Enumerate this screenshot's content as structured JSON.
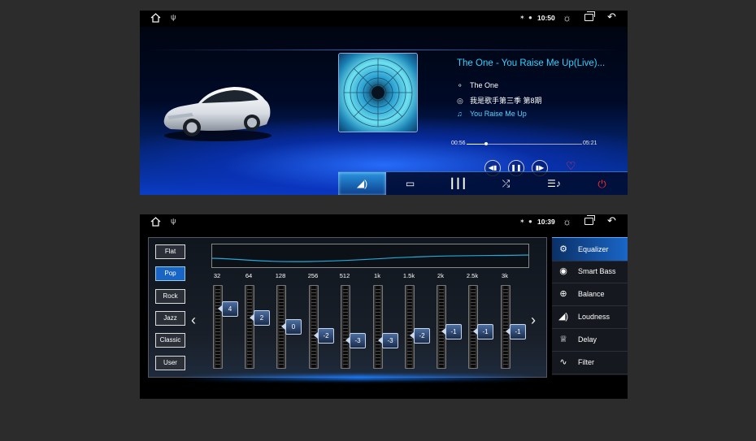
{
  "status1": {
    "time": "10:50"
  },
  "status2": {
    "time": "10:39"
  },
  "player": {
    "title": "The One - You Raise Me Up(Live)...",
    "artist": "The One",
    "album": "我是歌手第三季 第8期",
    "song": "You Raise Me Up",
    "current_time": "00:56",
    "total_time": "05:21",
    "progress": 0.17,
    "controls": {
      "prev": "prev-icon",
      "pause": "pause-icon",
      "next": "next-icon",
      "favorite": "heart-icon"
    },
    "tabs": [
      "volume-icon",
      "screen-mode-icon",
      "equalizer-icon",
      "shuffle-icon",
      "playlist-icon",
      "power-icon"
    ],
    "accent": "#35d0ff"
  },
  "equalizer": {
    "presets": [
      "Flat",
      "Pop",
      "Rock",
      "Jazz",
      "Classic",
      "User"
    ],
    "active_preset": "Pop",
    "bands": [
      {
        "freq": "32",
        "value": "4"
      },
      {
        "freq": "64",
        "value": "2"
      },
      {
        "freq": "128",
        "value": "0"
      },
      {
        "freq": "256",
        "value": "-2"
      },
      {
        "freq": "512",
        "value": "-3"
      },
      {
        "freq": "1k",
        "value": "-3"
      },
      {
        "freq": "1.5k",
        "value": "-2"
      },
      {
        "freq": "2k",
        "value": "-1"
      },
      {
        "freq": "2.5k",
        "value": "-1"
      },
      {
        "freq": "3k",
        "value": "-1"
      }
    ],
    "menu": [
      "Equalizer",
      "Smart Bass",
      "Balance",
      "Loudness",
      "Delay",
      "Filter"
    ],
    "active_menu": "Equalizer"
  }
}
